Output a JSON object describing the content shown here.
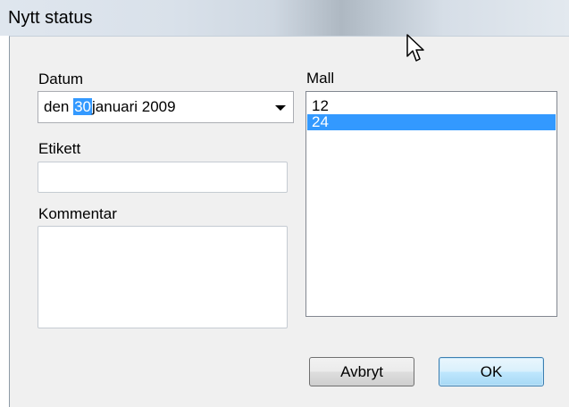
{
  "window": {
    "title": "Nytt status"
  },
  "form": {
    "datum_label": "Datum",
    "date": {
      "prefix": "den ",
      "day": "30",
      "rest": "januari 2009"
    },
    "etikett_label": "Etikett",
    "etikett_value": "",
    "kommentar_label": "Kommentar",
    "kommentar_value": "",
    "mall_label": "Mall",
    "mall_items": [
      {
        "label": "12",
        "selected": false
      },
      {
        "label": "24",
        "selected": true
      }
    ]
  },
  "buttons": {
    "cancel": "Avbryt",
    "ok": "OK"
  },
  "colors": {
    "selection": "#3399ff",
    "ok_border": "#3c7fb1"
  },
  "icons": {
    "date_dropdown": "chevron-down-icon",
    "cursor": "mouse-pointer-icon"
  }
}
